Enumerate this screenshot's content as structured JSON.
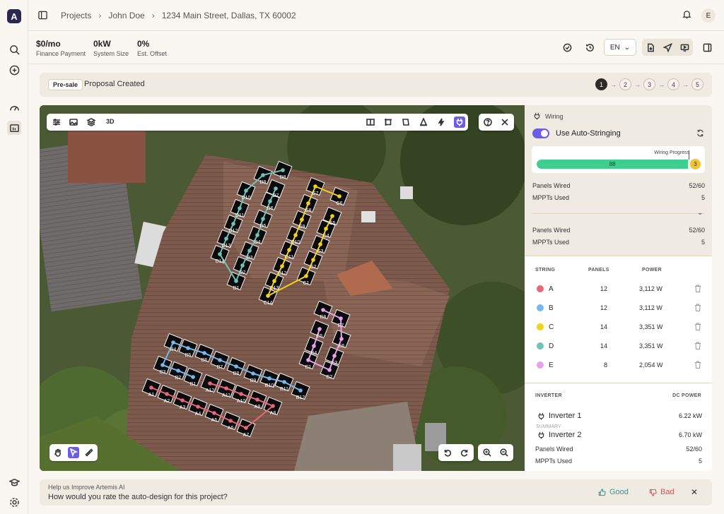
{
  "breadcrumb": {
    "projects": "Projects",
    "customer": "John Doe",
    "address": "1234 Main Street, Dallas, TX 60002"
  },
  "user_initial": "E",
  "stats": [
    {
      "value": "$0/mo",
      "label": "Finance Payment"
    },
    {
      "value": "0kW",
      "label": "System Size"
    },
    {
      "value": "0%",
      "label": "Est. Offset"
    }
  ],
  "language": "EN",
  "proposal": {
    "badge": "Pre-sale",
    "status": "Proposal Created",
    "steps": [
      "1",
      "2",
      "3",
      "4",
      "5"
    ],
    "active_step": "1"
  },
  "map_toolbar": {
    "label_3d": "3D"
  },
  "wiring": {
    "title": "Wiring",
    "auto_label": "Use Auto-Stringing",
    "progress_label": "Wiring Progress",
    "progress_wired": "88",
    "progress_warning": "3",
    "progress_fraction": 0.94,
    "summary": [
      {
        "label": "Panels Wired",
        "value": "52/60"
      },
      {
        "label": "MPPTs Used",
        "value": "5"
      }
    ],
    "summary2": [
      {
        "label": "Panels Wired",
        "value": "52/60"
      },
      {
        "label": "MPPTs Used",
        "value": "5"
      }
    ]
  },
  "strings_table": {
    "headers": {
      "string": "STRING",
      "panels": "PANELS",
      "power": "POWER"
    },
    "rows": [
      {
        "name": "A",
        "panels": "12",
        "power": "3,112 W",
        "color": "#e8677a"
      },
      {
        "name": "B",
        "panels": "12",
        "power": "3,112 W",
        "color": "#76b9ec"
      },
      {
        "name": "C",
        "panels": "14",
        "power": "3,351 W",
        "color": "#f2d31b"
      },
      {
        "name": "D",
        "panels": "14",
        "power": "3,351 W",
        "color": "#6fc3b5"
      },
      {
        "name": "E",
        "panels": "8",
        "power": "2,054 W",
        "color": "#e7a2ec"
      }
    ]
  },
  "inverters": {
    "header_left": "INVERTER",
    "header_right": "DC POWER",
    "items": [
      {
        "name": "Inverter 1",
        "power": "6.22 kW"
      },
      {
        "name": "Inverter 2",
        "power": "6.70 kW"
      }
    ],
    "overlap_text": "SUMMARY",
    "stats": [
      {
        "label": "Panels Wired",
        "value": "52/60"
      },
      {
        "label": "MPPTs Used",
        "value": "5"
      }
    ]
  },
  "feedback": {
    "small": "Help us Improve Artemis AI",
    "question": "How would you rate the auto-design for this project?",
    "good": "Good",
    "bad": "Bad",
    "close": "✕"
  },
  "panel_labels": {
    "D": [
      "D8",
      "D9",
      "D7",
      "D10",
      "D6",
      "D11",
      "D5",
      "D12",
      "D4",
      "D13",
      "D3",
      "D14",
      "D2",
      "D1"
    ],
    "C": [
      "C7",
      "C6",
      "C8",
      "C5",
      "C9",
      "C4",
      "C10",
      "C3",
      "C11",
      "C2",
      "C12",
      "C1",
      "C13",
      "C14"
    ],
    "B": [
      "B4",
      "B5",
      "B6",
      "B7",
      "B8",
      "B9",
      "B10",
      "B11",
      "B12",
      "B3",
      "B2",
      "B1"
    ],
    "A": [
      "A1",
      "A2",
      "A3",
      "A4",
      "A5",
      "A6",
      "A7",
      "A8",
      "A9",
      "A10",
      "A11",
      "A12"
    ],
    "E": [
      "E8",
      "E7",
      "E5",
      "E6",
      "E4",
      "E3",
      "E1",
      "E2"
    ]
  }
}
